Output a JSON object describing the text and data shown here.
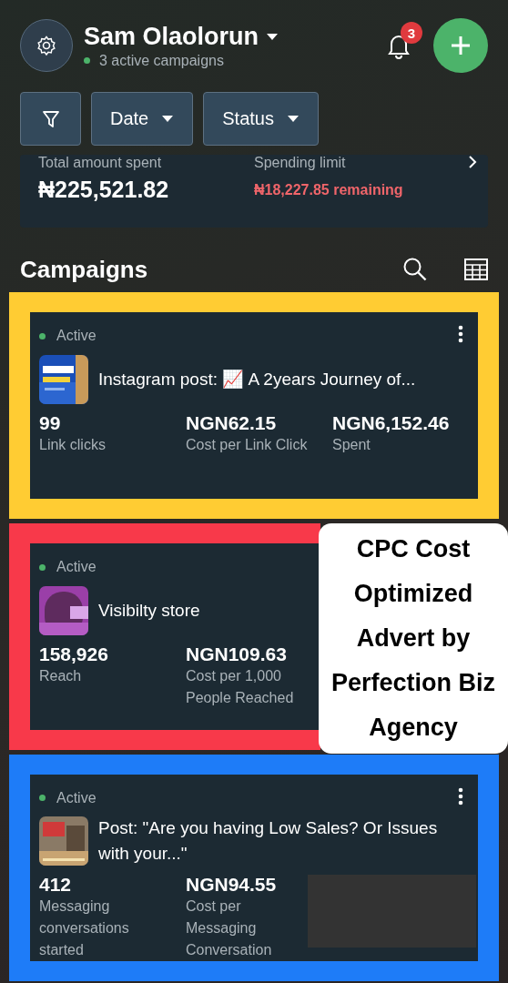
{
  "header": {
    "account_name": "Sam Olaolorun",
    "subtitle": "3 active campaigns",
    "notification_count": "3"
  },
  "filters": [
    {
      "kind": "icon"
    },
    {
      "kind": "dropdown",
      "label": "Date"
    },
    {
      "kind": "dropdown",
      "label": "Status"
    }
  ],
  "summary": {
    "total_label": "Total amount spent",
    "total_value": "₦225,521.82",
    "limit_label": "Spending limit",
    "limit_value": "₦18,227.85 remaining"
  },
  "campaigns_title": "Campaigns",
  "campaigns": [
    {
      "color": "#ffcc33",
      "status": "Active",
      "title": "Instagram post: 📈 A 2years Journey of...",
      "menu": true,
      "redacted": false,
      "metrics": [
        {
          "value": "99",
          "label": "Link clicks"
        },
        {
          "value": "NGN62.15",
          "label": "Cost per Link Click"
        },
        {
          "value": "NGN6,152.46",
          "label": "Spent"
        }
      ]
    },
    {
      "color": "#f8394a",
      "status": "Active",
      "title": "Visibilty store",
      "menu": false,
      "redacted": false,
      "metrics": [
        {
          "value": "158,926",
          "label": "Reach"
        },
        {
          "value": "NGN109.63",
          "label": "Cost per 1,000 People Reached"
        }
      ]
    },
    {
      "color": "#1e7cf8",
      "status": "Active",
      "title": "Post: \"Are you having Low Sales? Or Issues with your...\"",
      "menu": true,
      "redacted": true,
      "metrics": [
        {
          "value": "412",
          "label": "Messaging conversations started"
        },
        {
          "value": "NGN94.55",
          "label": "Cost per Messaging Conversation"
        }
      ]
    }
  ],
  "overlay_caption": "CPC Cost Optimized Advert by Perfection Biz Agency"
}
